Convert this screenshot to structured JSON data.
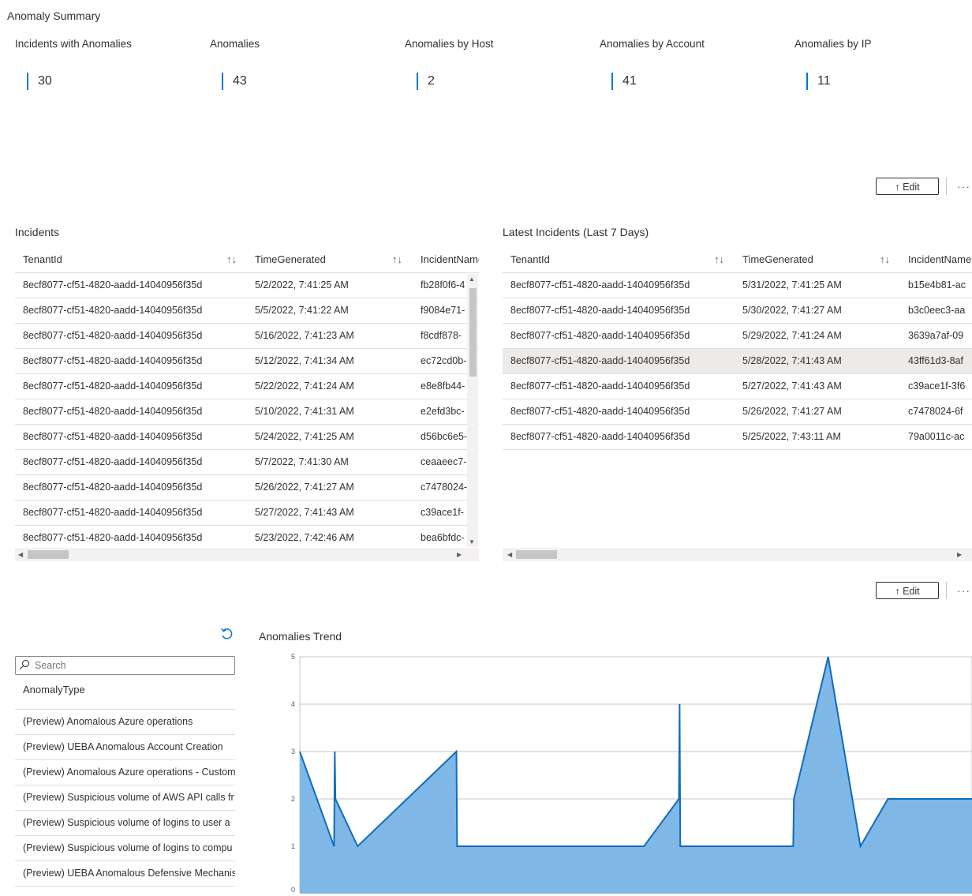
{
  "summary": {
    "title": "Anomaly Summary",
    "tiles": [
      {
        "label": "Incidents with Anomalies",
        "value": "30"
      },
      {
        "label": "Anomalies",
        "value": "43"
      },
      {
        "label": "Anomalies by Host",
        "value": "2"
      },
      {
        "label": "Anomalies by Account",
        "value": "41"
      },
      {
        "label": "Anomalies by IP",
        "value": "11"
      }
    ]
  },
  "toolbar1": {
    "edit_label": "Edit",
    "edit_icon": "↑",
    "more_label": "···"
  },
  "toolbar2": {
    "edit_label": "Edit",
    "edit_icon": "↑",
    "more_label": "···"
  },
  "sort_icon": "↑↓",
  "incidents": {
    "title": "Incidents",
    "columns": [
      "TenantId",
      "TimeGenerated",
      "IncidentName"
    ],
    "rows": [
      [
        "8ecf8077-cf51-4820-aadd-14040956f35d",
        "5/2/2022, 7:41:25 AM",
        "fb28f0f6-4"
      ],
      [
        "8ecf8077-cf51-4820-aadd-14040956f35d",
        "5/5/2022, 7:41:22 AM",
        "f9084e71-"
      ],
      [
        "8ecf8077-cf51-4820-aadd-14040956f35d",
        "5/16/2022, 7:41:23 AM",
        "f8cdf878-"
      ],
      [
        "8ecf8077-cf51-4820-aadd-14040956f35d",
        "5/12/2022, 7:41:34 AM",
        "ec72cd0b-"
      ],
      [
        "8ecf8077-cf51-4820-aadd-14040956f35d",
        "5/22/2022, 7:41:24 AM",
        "e8e8fb44-"
      ],
      [
        "8ecf8077-cf51-4820-aadd-14040956f35d",
        "5/10/2022, 7:41:31 AM",
        "e2efd3bc-"
      ],
      [
        "8ecf8077-cf51-4820-aadd-14040956f35d",
        "5/24/2022, 7:41:25 AM",
        "d56bc6e5-"
      ],
      [
        "8ecf8077-cf51-4820-aadd-14040956f35d",
        "5/7/2022, 7:41:30 AM",
        "ceaaeec7-"
      ],
      [
        "8ecf8077-cf51-4820-aadd-14040956f35d",
        "5/26/2022, 7:41:27 AM",
        "c7478024-"
      ],
      [
        "8ecf8077-cf51-4820-aadd-14040956f35d",
        "5/27/2022, 7:41:43 AM",
        "c39ace1f-"
      ],
      [
        "8ecf8077-cf51-4820-aadd-14040956f35d",
        "5/23/2022, 7:42:46 AM",
        "bea6bfdc-"
      ]
    ]
  },
  "latest": {
    "title": "Latest Incidents (Last 7 Days)",
    "columns": [
      "TenantId",
      "TimeGenerated",
      "IncidentName"
    ],
    "rows": [
      [
        "8ecf8077-cf51-4820-aadd-14040956f35d",
        "5/31/2022, 7:41:25 AM",
        "b15e4b81-ac"
      ],
      [
        "8ecf8077-cf51-4820-aadd-14040956f35d",
        "5/30/2022, 7:41:27 AM",
        "b3c0eec3-aa"
      ],
      [
        "8ecf8077-cf51-4820-aadd-14040956f35d",
        "5/29/2022, 7:41:24 AM",
        "3639a7af-09"
      ],
      [
        "8ecf8077-cf51-4820-aadd-14040956f35d",
        "5/28/2022, 7:41:43 AM",
        "43ff61d3-8af"
      ],
      [
        "8ecf8077-cf51-4820-aadd-14040956f35d",
        "5/27/2022, 7:41:43 AM",
        "c39ace1f-3f6"
      ],
      [
        "8ecf8077-cf51-4820-aadd-14040956f35d",
        "5/26/2022, 7:41:27 AM",
        "c7478024-6f"
      ],
      [
        "8ecf8077-cf51-4820-aadd-14040956f35d",
        "5/25/2022, 7:43:11 AM",
        "79a0011c-ac"
      ]
    ],
    "selected_row": 3
  },
  "anomaly_filter": {
    "search_placeholder": "Search",
    "column": "AnomalyType",
    "items": [
      "(Preview) Anomalous Azure operations",
      "(Preview) UEBA Anomalous Account Creation",
      "(Preview) Anomalous Azure operations - Custom",
      "(Preview) Suspicious volume of AWS API calls fr",
      "(Preview) Suspicious volume of logins to user a",
      "(Preview) Suspicious volume of logins to compu",
      "(Preview) UEBA Anomalous Defensive Mechanis"
    ]
  },
  "chart_data": {
    "type": "area",
    "title": "Anomalies Trend",
    "ylim": [
      0,
      5
    ],
    "yticks": [
      "0",
      "1",
      "2",
      "3",
      "4",
      "5"
    ],
    "xlim": [
      0,
      100
    ],
    "x": [
      0,
      5.1,
      5.2,
      5.3,
      8.6,
      23.3,
      23.4,
      51.2,
      56.4,
      56.5,
      56.6,
      73.4,
      73.5,
      78.6,
      83.4,
      87.5,
      100
    ],
    "values": [
      3,
      1,
      3,
      2,
      1,
      3,
      1,
      1,
      2,
      4,
      1,
      1,
      2,
      5,
      1,
      2,
      2
    ],
    "fill_color": "#7fb7e6",
    "line_color": "#0f6cbd",
    "grid": true
  }
}
